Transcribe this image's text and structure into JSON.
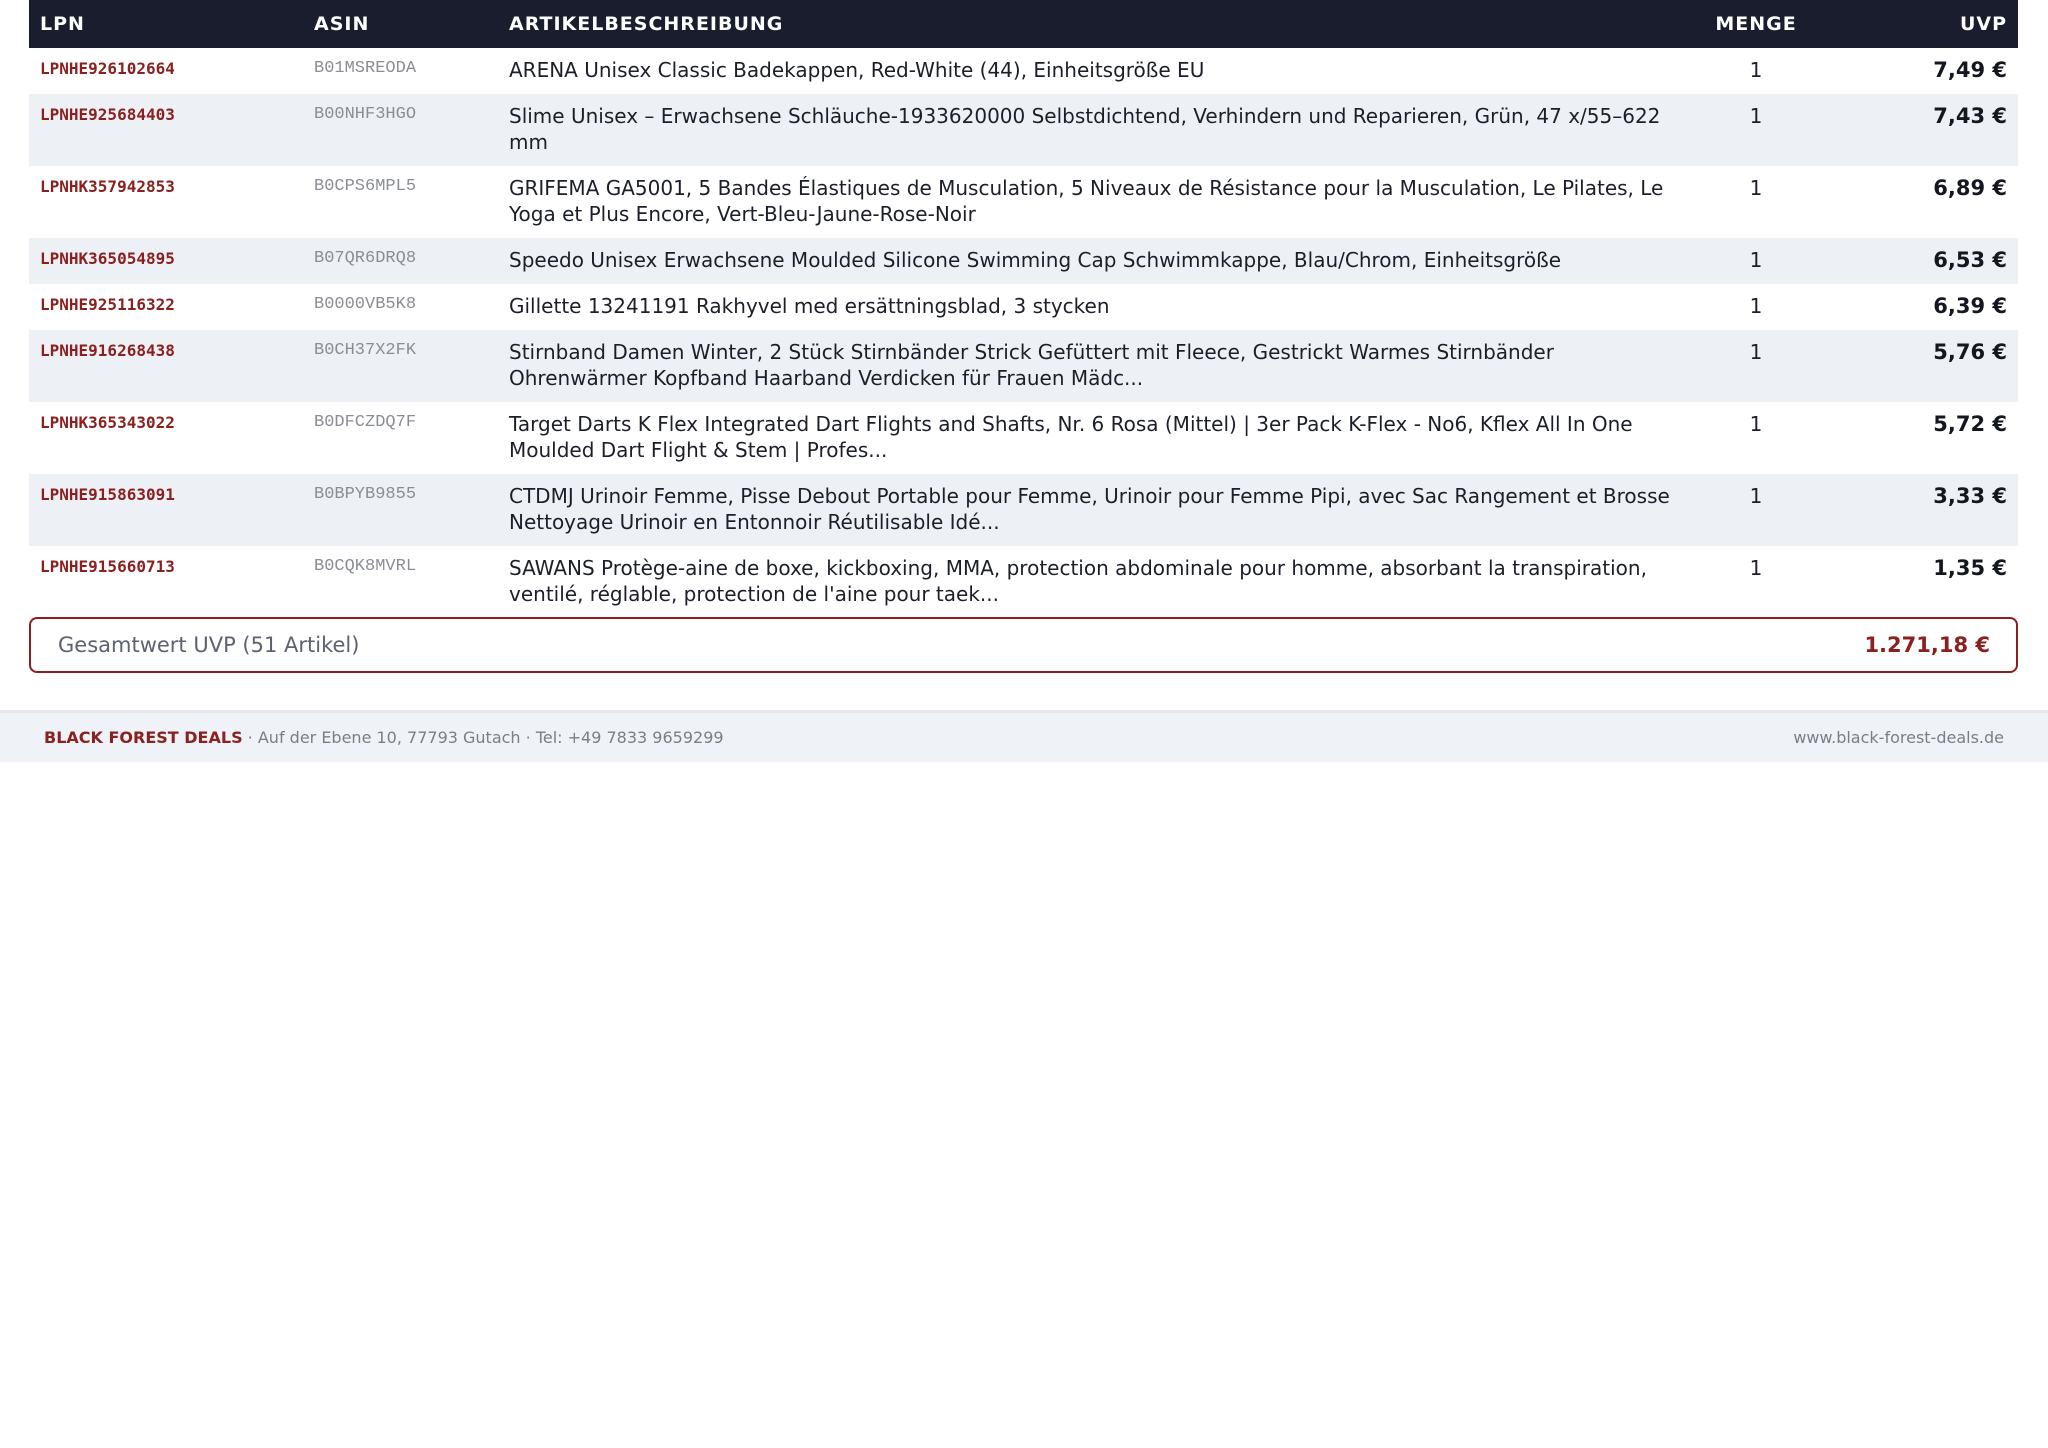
{
  "table": {
    "headers": {
      "lpn": "LPN",
      "asin": "ASIN",
      "description": "ARTIKELBESCHREIBUNG",
      "quantity": "MENGE",
      "price": "UVP"
    },
    "rows": [
      {
        "lpn": "LPNHE926102664",
        "asin": "B01MSREODA",
        "description": "ARENA Unisex Classic Badekappen, Red-White (44), Einheitsgröße EU",
        "quantity": "1",
        "price": "7,49 €"
      },
      {
        "lpn": "LPNHE925684403",
        "asin": "B00NHF3HGO",
        "description": "Slime Unisex – Erwachsene Schläuche-1933620000 Selbstdichtend, Verhindern und Reparieren, Grün, 47 x/55–622 mm",
        "quantity": "1",
        "price": "7,43 €"
      },
      {
        "lpn": "LPNHK357942853",
        "asin": "B0CPS6MPL5",
        "description": "GRIFEMA GA5001, 5 Bandes Élastiques de Musculation, 5 Niveaux de Résistance pour la Musculation, Le Pilates, Le Yoga et Plus Encore, Vert-Bleu-Jaune-Rose-Noir",
        "quantity": "1",
        "price": "6,89 €"
      },
      {
        "lpn": "LPNHK365054895",
        "asin": "B07QR6DRQ8",
        "description": "Speedo Unisex Erwachsene Moulded Silicone Swimming Cap Schwimmkappe, Blau/Chrom, Einheitsgröße",
        "quantity": "1",
        "price": "6,53 €"
      },
      {
        "lpn": "LPNHE925116322",
        "asin": "B0000VB5K8",
        "description": "Gillette 13241191 Rakhyvel med ersättningsblad, 3 stycken",
        "quantity": "1",
        "price": "6,39 €"
      },
      {
        "lpn": "LPNHE916268438",
        "asin": "B0CH37X2FK",
        "description": "Stirnband Damen Winter, 2 Stück Stirnbänder Strick Gefüttert mit Fleece, Gestrickt Warmes Stirnbänder Ohrenwärmer Kopfband Haarband Verdicken für Frauen Mädc...",
        "quantity": "1",
        "price": "5,76 €"
      },
      {
        "lpn": "LPNHK365343022",
        "asin": "B0DFCZDQ7F",
        "description": "Target Darts K Flex Integrated Dart Flights and Shafts, Nr. 6 Rosa (Mittel) | 3er Pack K-Flex - No6, Kflex All In One Moulded Dart Flight & Stem | Profes...",
        "quantity": "1",
        "price": "5,72 €"
      },
      {
        "lpn": "LPNHE915863091",
        "asin": "B0BPYB9855",
        "description": "CTDMJ Urinoir Femme, Pisse Debout Portable pour Femme, Urinoir pour Femme Pipi, avec Sac Rangement et Brosse Nettoyage Urinoir en Entonnoir Réutilisable Idé...",
        "quantity": "1",
        "price": "3,33 €"
      },
      {
        "lpn": "LPNHE915660713",
        "asin": "B0CQK8MVRL",
        "description": "SAWANS Protège-aine de boxe, kickboxing, MMA, protection abdominale pour homme, absorbant la transpiration, ventilé, réglable, protection de l'aine pour taek...",
        "quantity": "1",
        "price": "1,35 €"
      }
    ]
  },
  "total": {
    "label": "Gesamtwert UVP (51 Artikel)",
    "value": "1.271,18 €"
  },
  "footer": {
    "brand": "BLACK FOREST DEALS",
    "address": " · Auf der Ebene 10, 77793 Gutach · Tel: +49 7833 9659299",
    "website": "www.black-forest-deals.de"
  },
  "colors": {
    "header_bg": "#1a1d2e",
    "accent": "#8b2020",
    "row_alt": "#edf1f5",
    "footer_bg": "#eff2f7"
  }
}
